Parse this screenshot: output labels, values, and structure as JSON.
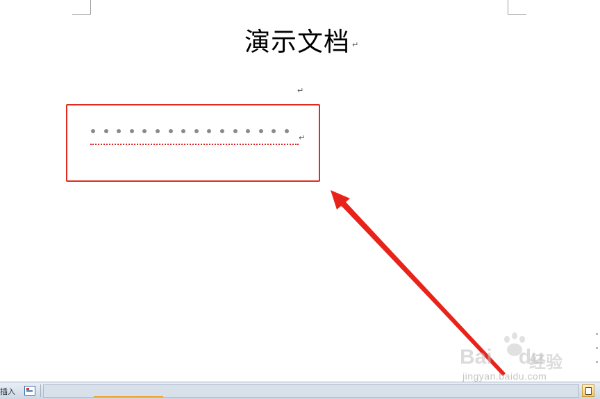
{
  "document": {
    "title": "演示文档",
    "paragraph_mark": "↵",
    "masked_line": {
      "dot_count": 16,
      "spell_error_underline": true
    }
  },
  "annotation": {
    "box_color": "#e02a1f",
    "arrow_color": "#e8231a"
  },
  "watermark": {
    "logo_text": "Bai",
    "logo_suffix": "du",
    "product": "经验",
    "url": "jingyan.baidu.com"
  },
  "statusbar": {
    "insert_mode": "插入",
    "proofing_icon": "document-proofing-icon",
    "view_icon": "print-layout-view-icon"
  },
  "colors": {
    "statusbar_bg": "#dfe6ef",
    "dot_color": "#8a8a8a"
  }
}
